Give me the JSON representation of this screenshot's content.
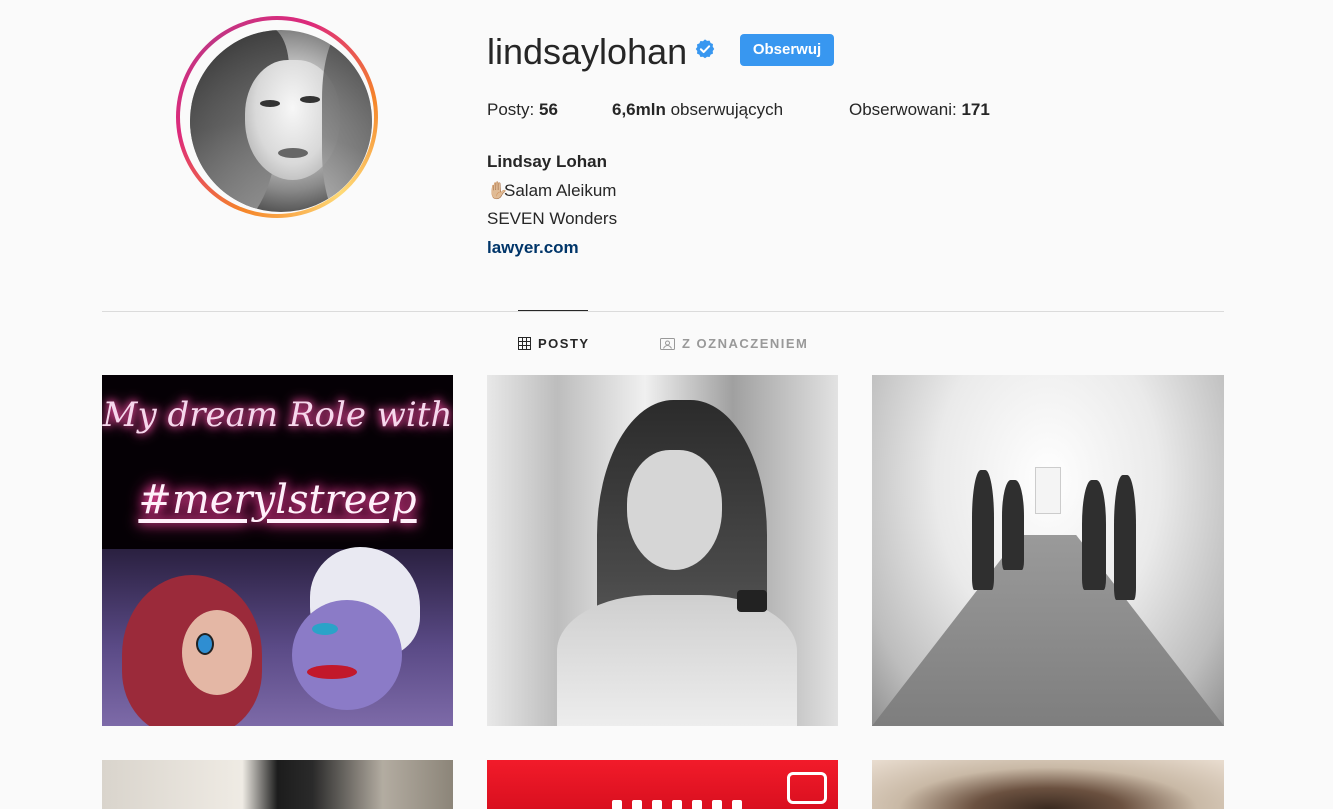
{
  "profile": {
    "username": "lindsaylohan",
    "follow_label": "Obserwuj",
    "stats": {
      "posts_label": "Posty:",
      "posts_value": "56",
      "followers_value": "6,6mln",
      "followers_label": "obserwujących",
      "following_label": "Obserwowani:",
      "following_value": "171"
    },
    "bio": {
      "full_name": "Lindsay Lohan",
      "line1": "Salam Aleikum",
      "line1_emoji": "✋🏼",
      "line2": "SEVEN Wonders",
      "link": "lawyer.com"
    }
  },
  "tabs": [
    {
      "label": "POSTY",
      "icon": "grid-icon",
      "active": true
    },
    {
      "label": "Z OZNACZENIEM",
      "icon": "tagged-icon",
      "active": false
    }
  ],
  "posts": {
    "post1": {
      "line1": "My dream Role with",
      "line2": "#merylstreep"
    }
  },
  "colors": {
    "accent": "#3897f0",
    "link": "#003569",
    "text": "#262626",
    "muted": "#999999",
    "background": "#fafafa"
  }
}
